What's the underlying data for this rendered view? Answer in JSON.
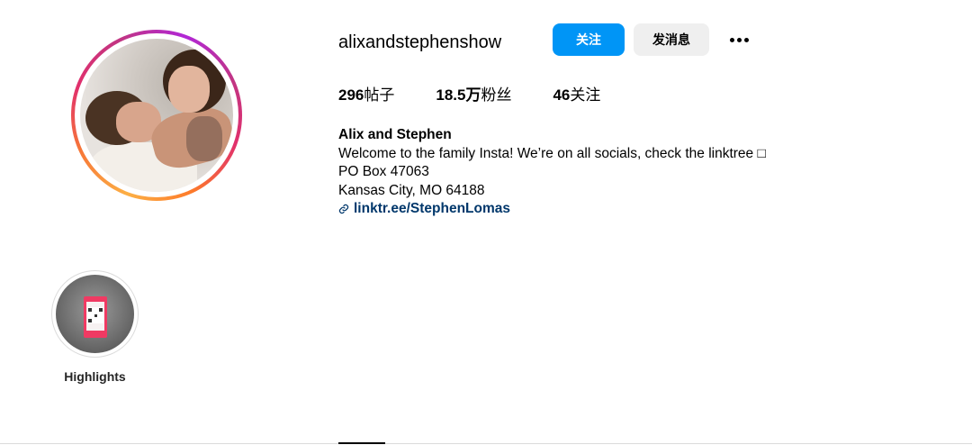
{
  "profile": {
    "username": "alixandstephenshow",
    "follow_label": "关注",
    "message_label": "发消息"
  },
  "stats": {
    "posts_count": "296",
    "posts_label": "帖子",
    "followers_count": "18.5万",
    "followers_label": "粉丝",
    "following_count": "46",
    "following_label": "关注"
  },
  "bio": {
    "name": "Alix and Stephen",
    "line1": "Welcome to the family Insta! We’re on all socials, check the linktree □",
    "line2": "PO Box 47063",
    "line3": "Kansas City, MO 64188",
    "link": "linktr.ee/StephenLomas"
  },
  "highlights": [
    {
      "label": "Highlights"
    }
  ],
  "colors": {
    "accent": "#0095f6",
    "link": "#00376b",
    "secondary_button": "#efefef"
  },
  "icons": {
    "more": "more-horizontal-icon",
    "link": "link-icon"
  }
}
